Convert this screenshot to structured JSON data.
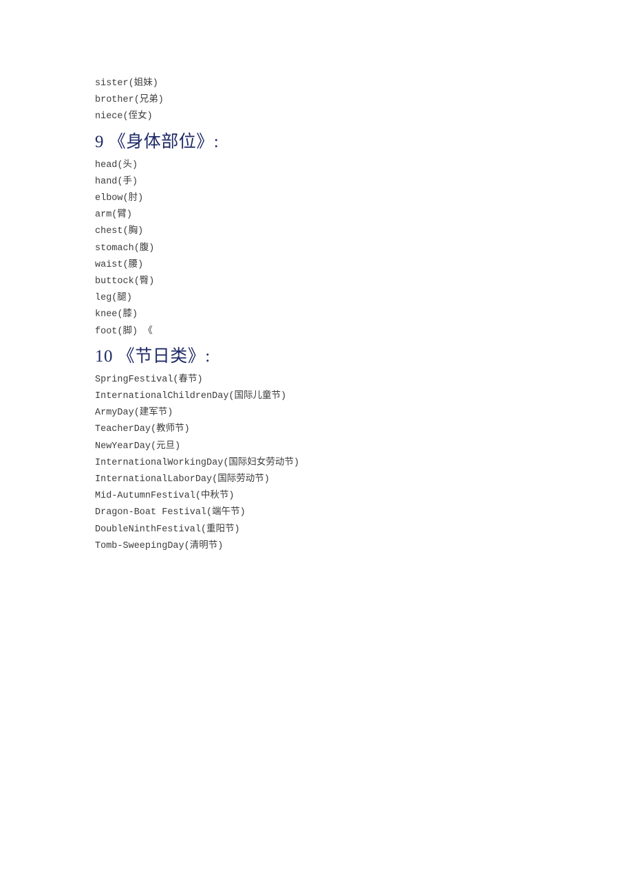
{
  "document": {
    "background_color": "#ffffff",
    "body_text_color": "#3b3b3b",
    "heading_color": "#1f2a66"
  },
  "intro_lines": [
    "sister(姐妹)",
    "brother(兄弟)",
    "niece(侄女)"
  ],
  "sections": [
    {
      "number": "9",
      "heading": "9 《身体部位》:",
      "title": "《身体部位》",
      "items": [
        "head(头)",
        "hand(手)",
        "elbow(肘)",
        "arm(臂)",
        "chest(胸)",
        "stomach(腹)",
        "waist(腰)",
        "buttock(臀)",
        "leg(腿)",
        "knee(膝)",
        "foot(脚) 《"
      ]
    },
    {
      "number": "10",
      "heading": "10 《节日类》:",
      "title": "《节日类》",
      "items": [
        "SpringFestival(春节)",
        "InternationalChildrenDay(国际儿童节)",
        "ArmyDay(建军节)",
        "TeacherDay(教师节)",
        "NewYearDay(元旦)",
        "InternationalWorkingDay(国际妇女劳动节)",
        "InternationalLaborDay(国际劳动节)",
        "Mid-AutumnFestival(中秋节)",
        "Dragon-Boat Festival(端午节)",
        "DoubleNinthFestival(重阳节)",
        "Tomb-SweepingDay(清明节)"
      ]
    }
  ]
}
